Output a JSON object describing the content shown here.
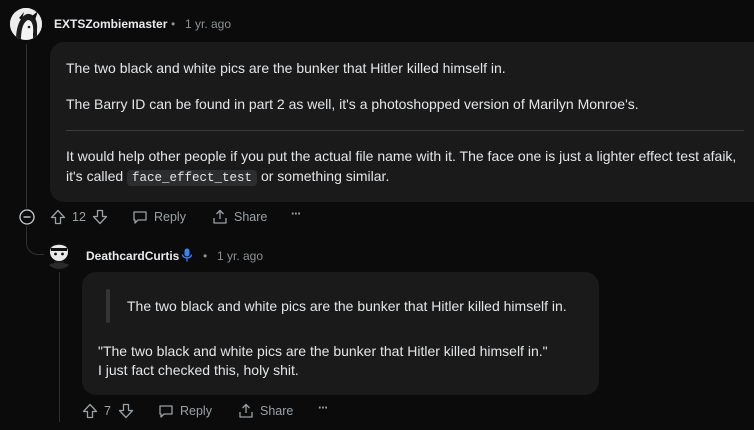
{
  "comment1": {
    "username": "EXTSZombiemaster",
    "time": "1 yr. ago",
    "paragraphs": [
      "The two black and white pics are the bunker that Hitler killed himself in.",
      "The Barry ID can be found in part 2 as well, it's a photoshopped version of Marilyn Monroe's."
    ],
    "after_divider": {
      "line1": "It would help other people if you put the actual file name with it. The face one is just a lighter effect test afaik,",
      "line2_prefix": "it's called ",
      "code": "face_effect_test",
      "line2_suffix": " or something similar."
    },
    "votes": "12",
    "reply_label": "Reply",
    "share_label": "Share",
    "more_label": "···"
  },
  "comment2": {
    "username": "DeathcardCurtis",
    "time": "1 yr. ago",
    "quote": "The two black and white pics are the bunker that Hitler killed himself in.",
    "line1": "\"The two black and white pics are the bunker that Hitler killed himself in.\"",
    "line2": "I just fact checked this, holy shit.",
    "votes": "7",
    "reply_label": "Reply",
    "share_label": "Share",
    "more_label": "···"
  },
  "colors": {
    "background": "#0b0b0b",
    "bubble": "#1a1a1b",
    "mic_badge": "#3b82f6"
  },
  "icons": [
    "upvote-icon",
    "downvote-icon",
    "comment-icon",
    "share-icon",
    "more-icon",
    "collapse-icon",
    "mic-icon"
  ]
}
